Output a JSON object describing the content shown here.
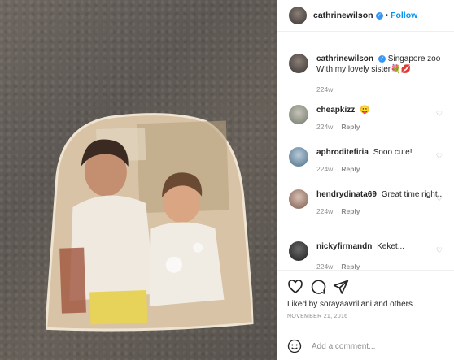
{
  "header": {
    "username": "cathrinewilson",
    "follow_label": "Follow",
    "dot": "•"
  },
  "caption": {
    "username": "cathrinewilson",
    "text": "Singapore zoo With my lovely sister💐💋",
    "age": "224w"
  },
  "comments": [
    {
      "username": "cheapkizz",
      "text": "😛",
      "age": "224w",
      "reply": "Reply"
    },
    {
      "username": "aphroditefiria",
      "text": "Sooo cute!",
      "age": "224w",
      "reply": "Reply"
    },
    {
      "username": "hendrydinata69",
      "text": "Great time right...",
      "age": "224w",
      "reply": "Reply"
    },
    {
      "username": "nickyfirmandn",
      "text": "Keket...",
      "age": "224w",
      "reply": "Reply"
    }
  ],
  "likes_text": "Liked by sorayaavriliani and others",
  "date": "NOVEMBER 21, 2016",
  "add_comment_placeholder": "Add a comment...",
  "icons": [
    "heart-icon",
    "comment-icon",
    "share-icon",
    "smile-icon",
    "verified-icon"
  ],
  "colors": {
    "follow_blue": "#0095f6",
    "verified_blue": "#3897f0",
    "muted_gray": "#8e8e8e"
  }
}
